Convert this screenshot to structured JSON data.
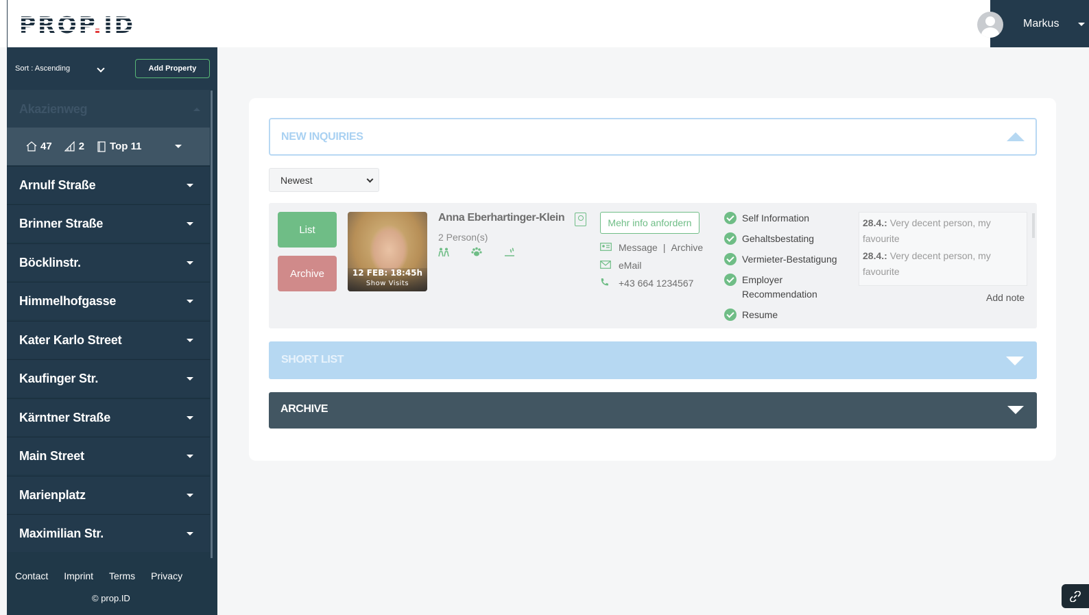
{
  "header": {
    "logo_text": "PROP",
    "logo_dot": ".",
    "logo_suffix": "ID",
    "user_name": "Markus"
  },
  "sidebar": {
    "sort_label": "Sort :  Ascending",
    "add_property_label": "Add Property",
    "active_property": "Akazienweg",
    "stats": {
      "units": "47",
      "floors": "2",
      "top": "Top 11"
    },
    "streets": [
      "Arnulf Straße",
      "Brinner Straße",
      "Böcklinstr.",
      "Himmelhofgasse",
      "Kater Karlo Street",
      "Kaufinger Str.",
      "Kärntner Straße",
      "Main Street",
      "Marienplatz",
      "Maximilian Str."
    ],
    "footer_links": [
      "Contact",
      "Imprint",
      "Terms",
      "Privacy"
    ],
    "copyright": "© prop.ID"
  },
  "main": {
    "new_inquiries_title": "NEW INQUIRIES",
    "sort_select_value": "Newest",
    "inquiry": {
      "list_label": "List",
      "archive_label": "Archive",
      "visit_date": "12 FEB: 18:45h",
      "show_visits": "Show Visits",
      "name": "Anna Eberhartinger-Klein",
      "persons": "2 Person(s)",
      "mehr_info": "Mehr info anfordern",
      "message": "Message",
      "separator": "|",
      "archive_link": "Archive",
      "email": "eMail",
      "phone": "+43 664 1234567",
      "documents": [
        "Self Information",
        "Gehaltsbestating",
        "Vermieter-Bestatigung",
        "Employer Recommendation",
        "Resume"
      ],
      "notes": [
        {
          "date": "28.4.:",
          "text": " Very decent person, my favourite"
        },
        {
          "date": "28.4.:",
          "text": " Very decent person, my favourite"
        }
      ],
      "add_note": "Add note"
    },
    "short_list_title": "SHORT LIST",
    "archive_title": "ARCHIVE"
  },
  "colors": {
    "sidebar_bg": "#203848",
    "accent_green": "#6fbd86",
    "archive_red": "#d08a8a",
    "light_blue": "#b6d8f2"
  }
}
